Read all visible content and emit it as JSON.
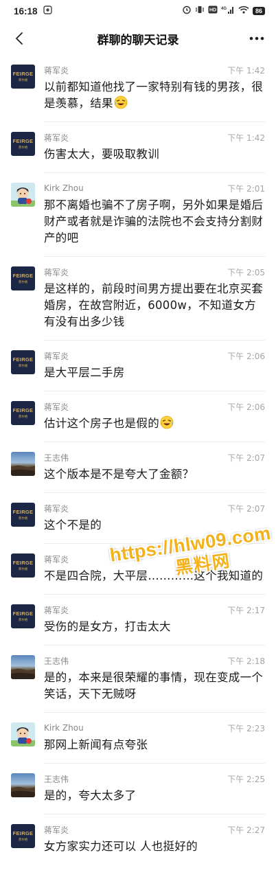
{
  "status": {
    "time": "16:18",
    "battery": "86",
    "network": "4G"
  },
  "header": {
    "title": "群聊的聊天记录",
    "back_icon": "chevron-left-icon",
    "more_icon": "more-dots-icon"
  },
  "avatars": {
    "feirge_line1": "FEIRGE",
    "feirge_line2": "菲尔格"
  },
  "messages": [
    {
      "sender": "蒋军炎",
      "avatar": "feirge",
      "time": "下午 1:42",
      "text": "以前都知道他找了一家特别有钱的男孩，很是羡慕，结果",
      "emoji": "laughing-tears-emoji"
    },
    {
      "sender": "蒋军炎",
      "avatar": "feirge",
      "time": "下午 1:42",
      "text": "伤害太大，要吸取教训"
    },
    {
      "sender": "Kirk Zhou",
      "avatar": "kirk",
      "time": "下午 2:01",
      "text": "那不离婚也骗不了房子啊，另外如果是婚后财产或者就是诈骗的法院也不会支持分割财产的吧"
    },
    {
      "sender": "蒋军炎",
      "avatar": "feirge",
      "time": "下午 2:05",
      "text": "是这样的，前段时间男方提出要在北京买套婚房，在故宫附近，6000w，不知道女方有没有出多少钱"
    },
    {
      "sender": "蒋军炎",
      "avatar": "feirge",
      "time": "下午 2:06",
      "text": "是大平层二手房"
    },
    {
      "sender": "蒋军炎",
      "avatar": "feirge",
      "time": "下午 2:06",
      "text": "估计这个房子也是假的",
      "emoji": "laughing-tears-emoji"
    },
    {
      "sender": "王志伟",
      "avatar": "wang",
      "time": "下午 2:07",
      "text": "这个版本是不是夸大了金额？"
    },
    {
      "sender": "蒋军炎",
      "avatar": "feirge",
      "time": "下午 2:07",
      "text": "这个不是的"
    },
    {
      "sender": "蒋军炎",
      "avatar": "feirge",
      "time": "",
      "text": "不是四合院，大平层…………这个我知道的"
    },
    {
      "sender": "蒋军炎",
      "avatar": "feirge",
      "time": "下午 2:17",
      "text": "受伤的是女方，打击太大"
    },
    {
      "sender": "王志伟",
      "avatar": "wang",
      "time": "下午 2:18",
      "text": "是的，本来是很荣耀的事情，现在变成一个笑话，天下无贼呀"
    },
    {
      "sender": "Kirk Zhou",
      "avatar": "kirk",
      "time": "下午 2:23",
      "text": "那网上新闻有点夸张"
    },
    {
      "sender": "王志伟",
      "avatar": "wang",
      "time": "下午 2:25",
      "text": "是的，夸大太多了"
    },
    {
      "sender": "蒋军炎",
      "avatar": "feirge",
      "time": "下午 2:27",
      "text": "女方家实力还可以 人也挺好的"
    }
  ],
  "watermark": {
    "line1": "https://hlw09.com",
    "line2": "黑料网"
  },
  "colors": {
    "feirge_bg": "#1b2744",
    "feirge_gold": "#d7b05c",
    "watermark": "#f4b21a",
    "time_gray": "#a5a5a5",
    "name_gray": "#888888"
  }
}
